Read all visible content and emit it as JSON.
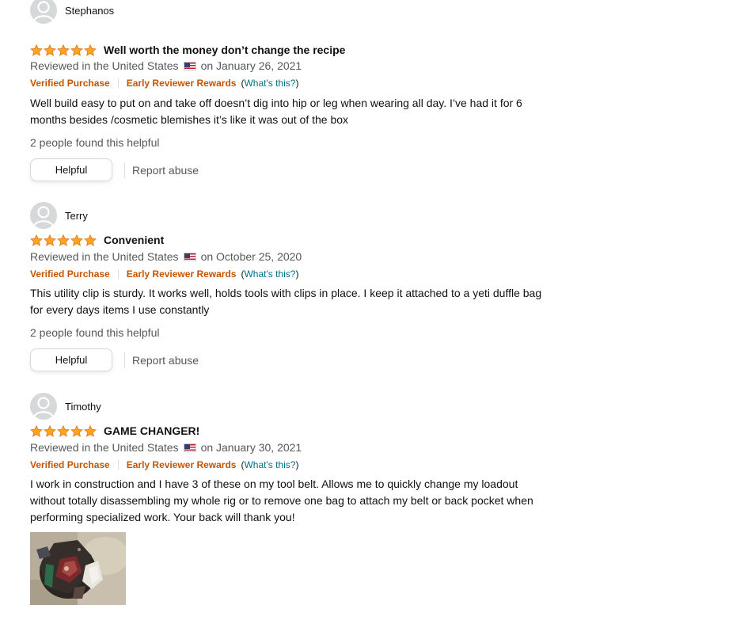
{
  "reviews": [
    {
      "profile_name": "Stephanos",
      "rating": 5,
      "title": "Well worth the money don’t change the recipe",
      "date_prefix": "Reviewed in the United States",
      "date_suffix": "on January 26, 2021",
      "verified": "Verified Purchase",
      "early": "Early Reviewer Rewards",
      "whats_this": "What's this?",
      "body_lines": [
        "Well build easy to put on and take off doesn’t dig into hip or leg when wearing all day. I’ve had it for 6",
        "months besides /cosmetic blemishes it’s like it was out of the box"
      ],
      "helpful_count": "2 people found this helpful",
      "helpful_label": "Helpful",
      "report_label": "Report abuse"
    },
    {
      "profile_name": "Terry",
      "rating": 5,
      "title": "Convenient",
      "date_prefix": "Reviewed in the United States",
      "date_suffix": "on October 25, 2020",
      "verified": "Verified Purchase",
      "early": "Early Reviewer Rewards",
      "whats_this": "What's this?",
      "body_lines": [
        "This utility clip is sturdy. It works well, holds tools with clips in place. I keep it attached to a yeti duffle bag",
        "for every days items I use constantly"
      ],
      "helpful_count": "2 people found this helpful",
      "helpful_label": "Helpful",
      "report_label": "Report abuse"
    },
    {
      "profile_name": "Timothy",
      "rating": 5,
      "title": "GAME CHANGER!",
      "date_prefix": "Reviewed in the United States",
      "date_suffix": "on January 30, 2021",
      "verified": "Verified Purchase",
      "early": "Early Reviewer Rewards",
      "whats_this": "What's this?",
      "body_lines": [
        "I work in construction and I have 3 of these on my tool belt. Allows me to quickly change my loadout",
        "without totally disassembling my whole rig or to remove one bag to attach my belt or back pocket when",
        "performing specialized work. Your back will thank you!"
      ]
    }
  ],
  "colors": {
    "star": "#ffa41c",
    "star_stroke": "#de7921",
    "badge": "#c45500",
    "link": "#007185",
    "muted": "#565959"
  },
  "icons": {
    "avatar": "default-avatar-icon",
    "star": "star-icon",
    "flag": "us-flag-icon"
  }
}
